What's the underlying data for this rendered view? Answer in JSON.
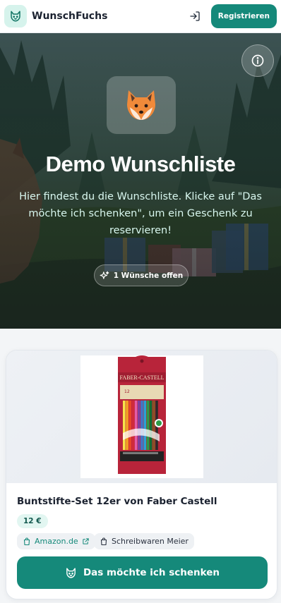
{
  "header": {
    "app_name": "WunschFuchs",
    "logo_icon": "fox-logo-icon",
    "login_icon": "login-icon",
    "register_label": "Registrieren"
  },
  "hero": {
    "info_icon": "info-icon",
    "emoji": "🦊",
    "title": "Demo Wunschliste",
    "subtitle": "Hier findest du die Wunschliste. Klicke auf \"Das möchte ich schenken\", um ein Geschenk zu reservieren!",
    "badge_icon": "sparkles-icon",
    "badge_label": "1 Wünsche offen"
  },
  "item": {
    "brand_on_package": "FABER-CASTELL",
    "package_count": "12",
    "title": "Buntstifte-Set 12er von Faber Castell",
    "price": "12 €",
    "shop_label": "Amazon.de",
    "shop_icon": "shopping-bag-icon",
    "external_icon": "external-link-icon",
    "tag_label": "Schreibwaren Meier",
    "tag_icon": "shopping-bag-icon",
    "gift_button_label": "Das möchte ich schenken",
    "gift_button_icon": "fox-icon"
  },
  "colors": {
    "accent": "#15897a",
    "accent_light": "#e2f6f1",
    "logo_bg": "#d6f3ec",
    "page_bg": "#f3f5f7"
  }
}
